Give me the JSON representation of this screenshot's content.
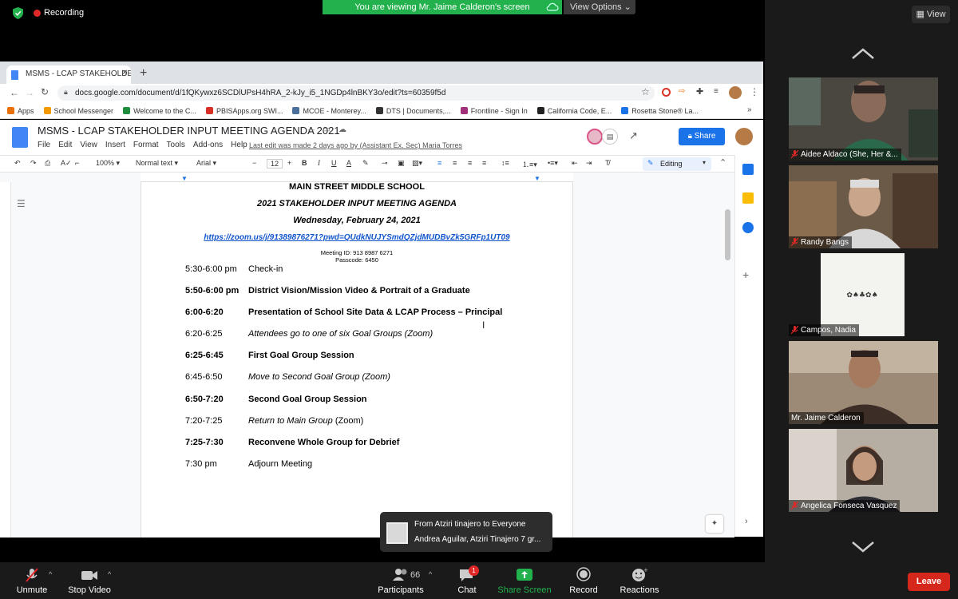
{
  "zoom": {
    "recording_label": "Recording",
    "viewing_banner": "You are viewing Mr. Jaime Calderon's screen",
    "view_options": "View Options",
    "view_button": "View",
    "participants": [
      {
        "name": "Aidee Aldaco (She, Her &..."
      },
      {
        "name": "Randy Bangs"
      },
      {
        "name": "Campos, Nadia"
      },
      {
        "name": "Mr. Jaime Calderon"
      },
      {
        "name": "Angelica Fonseca Vasquez"
      }
    ],
    "bottom": {
      "unmute": "Unmute",
      "stop_video": "Stop Video",
      "participants": "Participants",
      "participant_count": "66",
      "chat": "Chat",
      "chat_badge": "1",
      "share_screen": "Share Screen",
      "record": "Record",
      "reactions": "Reactions",
      "leave": "Leave"
    },
    "chat_popup": {
      "from": "From Atziri tinajero to Everyone",
      "message": "Andrea Aguilar, Atziri Tinajero 7 gr..."
    },
    "colors": {
      "green": "#22b14c",
      "leave": "#d6271c",
      "share_screen": "#22b14c"
    }
  },
  "browser": {
    "tab_title": "MSMS - LCAP STAKEHOLDER",
    "url": "docs.google.com/document/d/1fQKywxz6SCDlUPsH4hRA_2-kJy_i5_1NGDp4lnBKY3o/edit?ts=60359f5d",
    "bookmarks": [
      "Apps",
      "School Messenger",
      "Welcome to the C...",
      "PBISApps.org SWI...",
      "MCOE - Monterey...",
      "DTS | Documents,...",
      "Frontline - Sign In",
      "California Code, E...",
      "Rosetta Stone® La..."
    ]
  },
  "docs": {
    "title": "MSMS - LCAP STAKEHOLDER INPUT MEETING AGENDA 2021",
    "menu": [
      "File",
      "Edit",
      "View",
      "Insert",
      "Format",
      "Tools",
      "Add-ons",
      "Help"
    ],
    "last_edit": "Last edit was made 2 days ago by (Assistant Ex. Sec) Maria Torres",
    "share": "Share",
    "toolbar": {
      "zoom": "100%",
      "style": "Normal text",
      "font": "Arial",
      "size": "12",
      "mode": "Editing"
    },
    "content": {
      "school": "MAIN STREET MIDDLE SCHOOL",
      "heading": "2021 STAKEHOLDER INPUT MEETING AGENDA",
      "date": "Wednesday, February 24, 2021",
      "link": "https://zoom.us/j/91389876271?pwd=QUdkNUJYSmdQZjdMUDBvZk5GRFp1UT09",
      "meeting_id": "Meeting ID: 913 8987 6271",
      "passcode": "Passcode: 6450",
      "agenda": [
        {
          "time": "5:30-6:00 pm",
          "item": "Check-in"
        },
        {
          "time": "5:50-6:00 pm",
          "item": "District Vision/Mission Video & Portrait of a Graduate"
        },
        {
          "time": "6:00-6:20",
          "item": "Presentation of School Site Data & LCAP Process – Principal"
        },
        {
          "time": "6:20-6:25",
          "item": "Attendees go to one of six Goal Groups (Zoom)"
        },
        {
          "time": "6:25-6:45",
          "item": "First Goal Group Session"
        },
        {
          "time": "6:45-6:50",
          "item": "Move to Second Goal Group (Zoom)"
        },
        {
          "time": "6:50-7:20",
          "item": "Second Goal Group Session"
        },
        {
          "time": "7:20-7:25",
          "item_italic": "Return to Main Group",
          "item_tail": " (Zoom)"
        },
        {
          "time": "7:25-7:30",
          "item": "Reconvene Whole Group for Debrief"
        },
        {
          "time": "7:30 pm",
          "item": "Adjourn Meeting"
        }
      ]
    }
  }
}
